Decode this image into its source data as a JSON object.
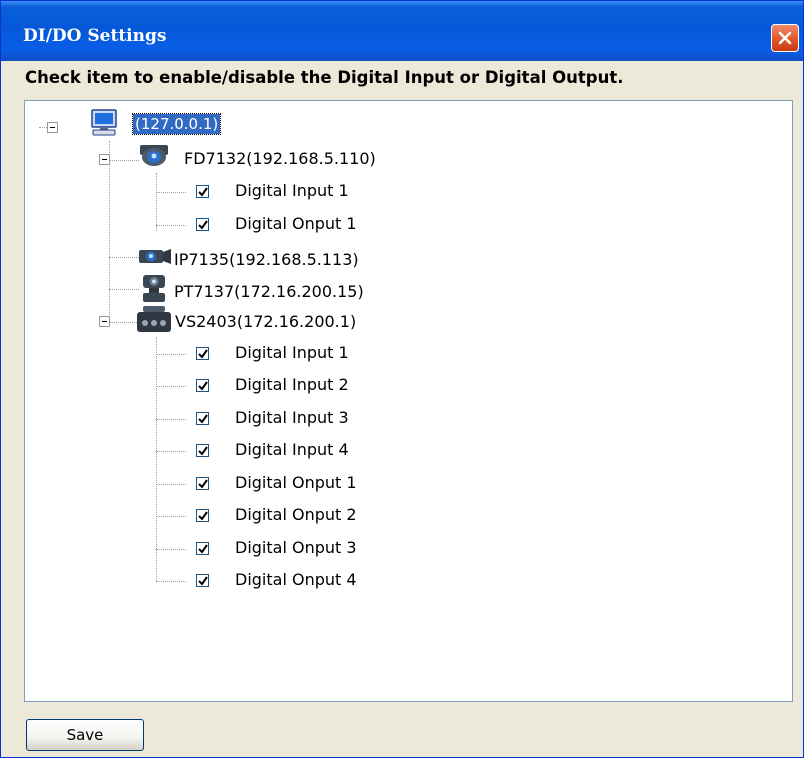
{
  "window": {
    "title": "DI/DO Settings"
  },
  "instruction": "Check item to enable/disable the Digital Input or Digital Output.",
  "tree": {
    "root": {
      "label": "(127.0.0.1)",
      "icon": "computer-icon",
      "selected": true
    },
    "devices": [
      {
        "label": "FD7132(192.168.5.110)",
        "icon": "dome-camera-icon",
        "items": [
          {
            "label": "Digital Input 1",
            "checked": true
          },
          {
            "label": "Digital Onput 1",
            "checked": true
          }
        ]
      },
      {
        "label": "IP7135(192.168.5.113)",
        "icon": "box-camera-icon",
        "items": []
      },
      {
        "label": "PT7137(172.16.200.15)",
        "icon": "ptz-camera-icon",
        "items": []
      },
      {
        "label": "VS2403(172.16.200.1)",
        "icon": "video-server-icon",
        "items": [
          {
            "label": "Digital Input 1",
            "checked": true
          },
          {
            "label": "Digital Input 2",
            "checked": true
          },
          {
            "label": "Digital Input 3",
            "checked": true
          },
          {
            "label": "Digital Input 4",
            "checked": true
          },
          {
            "label": "Digital Onput 1",
            "checked": true
          },
          {
            "label": "Digital Onput 2",
            "checked": true
          },
          {
            "label": "Digital Onput 3",
            "checked": true
          },
          {
            "label": "Digital Onput 4",
            "checked": true
          }
        ]
      }
    ]
  },
  "buttons": {
    "save_label": "Save"
  },
  "colors": {
    "titlebar": "#0458d8",
    "selection": "#316ac5",
    "close": "#e25a2e"
  }
}
